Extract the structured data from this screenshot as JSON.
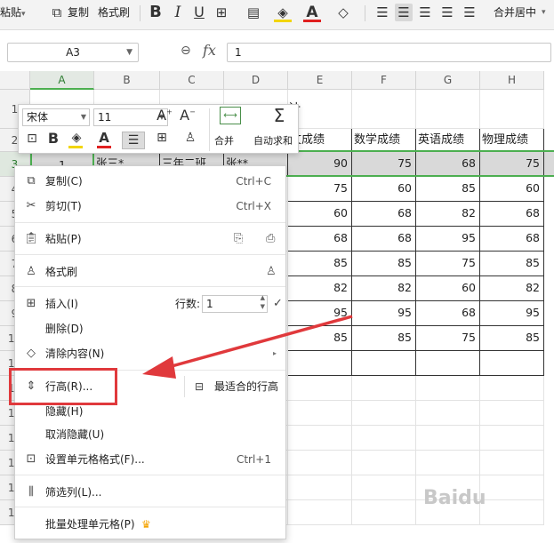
{
  "toolbar": {
    "paste_label": "粘贴",
    "copy_label": "复制",
    "format_painter_label": "格式刷",
    "merge_center_label": "合并居中"
  },
  "formula_bar": {
    "name_box": "A3",
    "fx_symbol": "fx",
    "content": "1"
  },
  "columns": [
    "A",
    "B",
    "C",
    "D",
    "E",
    "F",
    "G",
    "H"
  ],
  "rows": [
    "1",
    "2",
    "3",
    "4",
    "5",
    "6",
    "7",
    "8",
    "9",
    "10",
    "11",
    "12",
    "13",
    "14",
    "15",
    "16",
    "17"
  ],
  "sheet": {
    "title_fragment": "计",
    "headers": {
      "E": "文成绩",
      "F": "数学成绩",
      "G": "英语成绩",
      "H": "物理成绩"
    },
    "row3": {
      "A": "1",
      "B": "张三*",
      "C": "三年二班",
      "D": "张**",
      "E": "90",
      "F": "75",
      "G": "68",
      "H": "75"
    },
    "data": [
      [
        "75",
        "60",
        "85",
        "60"
      ],
      [
        "60",
        "68",
        "82",
        "68"
      ],
      [
        "68",
        "68",
        "95",
        "68"
      ],
      [
        "85",
        "85",
        "75",
        "85"
      ],
      [
        "82",
        "82",
        "60",
        "82"
      ],
      [
        "95",
        "95",
        "68",
        "95"
      ],
      [
        "85",
        "85",
        "75",
        "85"
      ]
    ]
  },
  "mini_toolbar": {
    "font_name": "宋体",
    "font_size": "11",
    "merge_label": "合并",
    "autosum_label": "自动求和"
  },
  "context_menu": {
    "copy": {
      "label": "复制(C)",
      "shortcut": "Ctrl+C"
    },
    "cut": {
      "label": "剪切(T)",
      "shortcut": "Ctrl+X"
    },
    "paste": {
      "label": "粘贴(P)"
    },
    "format_painter": {
      "label": "格式刷"
    },
    "insert": {
      "label": "插入(I)",
      "rows_label": "行数:",
      "rows_value": "1"
    },
    "delete": {
      "label": "删除(D)"
    },
    "clear": {
      "label": "清除内容(N)"
    },
    "row_height": {
      "label": "行高(R)...",
      "best_fit": "最适合的行高"
    },
    "hide": {
      "label": "隐藏(H)"
    },
    "unhide": {
      "label": "取消隐藏(U)"
    },
    "format_cells": {
      "label": "设置单元格格式(F)...",
      "shortcut": "Ctrl+1"
    },
    "filter_column": {
      "label": "筛选列(L)..."
    },
    "batch_process": {
      "label": "批量处理单元格(P)"
    }
  },
  "colors": {
    "accent": "#4caf50",
    "highlight": "#e0393c",
    "crown": "#f4a300"
  }
}
